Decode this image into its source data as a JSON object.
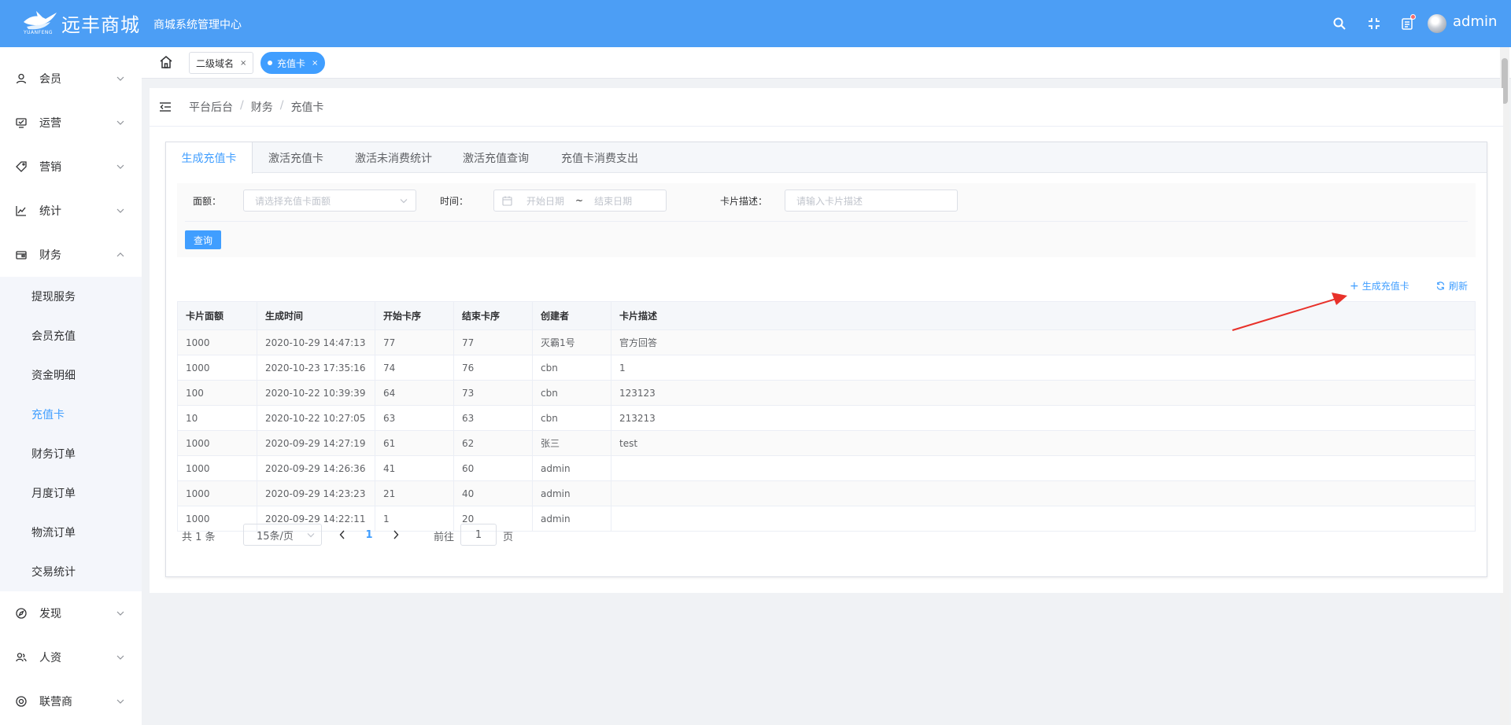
{
  "header": {
    "logo_text": "远丰商城",
    "logo_sub": "YUANFENG",
    "title": "商城系统管理中心",
    "username": "admin",
    "icons": [
      "search-icon",
      "fullscreen-icon",
      "notification-icon"
    ]
  },
  "sidebar": {
    "items": [
      {
        "label": "会员",
        "icon": "user-icon"
      },
      {
        "label": "运营",
        "icon": "monitor-icon"
      },
      {
        "label": "营销",
        "icon": "tag-icon"
      },
      {
        "label": "统计",
        "icon": "chart-line-icon"
      },
      {
        "label": "财务",
        "icon": "wallet-icon"
      },
      {
        "label": "发现",
        "icon": "compass-icon"
      },
      {
        "label": "人资",
        "icon": "people-icon"
      },
      {
        "label": "联营商",
        "icon": "partner-icon"
      }
    ],
    "finance_sub": [
      "提现服务",
      "会员充值",
      "资金明细",
      "充值卡",
      "财务订单",
      "月度订单",
      "物流订单",
      "交易统计"
    ],
    "active_sub": "充值卡"
  },
  "tags": {
    "items": [
      {
        "label": "二级域名"
      },
      {
        "label": "充值卡"
      }
    ],
    "close_glyph": "×"
  },
  "breadcrumb": [
    "平台后台",
    "财务",
    "充值卡"
  ],
  "breadcrumb_sep": "/",
  "tabs": [
    "生成充值卡",
    "激活充值卡",
    "激活未消费统计",
    "激活充值查询",
    "充值卡消费支出"
  ],
  "filters": {
    "amount_label": "面额：",
    "amount_placeholder": "请选择充值卡面额",
    "time_label": "时间：",
    "start_placeholder": "开始日期",
    "range_sep": "~",
    "end_placeholder": "结束日期",
    "desc_label": "卡片描述：",
    "desc_placeholder": "请输入卡片描述",
    "query_button": "查询"
  },
  "actions": {
    "generate": "生成充值卡",
    "refresh": "刷新"
  },
  "table": {
    "columns": [
      "卡片面额",
      "生成时间",
      "开始卡序",
      "结束卡序",
      "创建者",
      "卡片描述"
    ],
    "rows": [
      [
        "1000",
        "2020-10-29 14:47:13",
        "77",
        "77",
        "灭霸1号",
        "官方回答"
      ],
      [
        "1000",
        "2020-10-23 17:35:16",
        "74",
        "76",
        "cbn",
        "1"
      ],
      [
        "100",
        "2020-10-22 10:39:39",
        "64",
        "73",
        "cbn",
        "123123"
      ],
      [
        "10",
        "2020-10-22 10:27:05",
        "63",
        "63",
        "cbn",
        "213213"
      ],
      [
        "1000",
        "2020-09-29 14:27:19",
        "61",
        "62",
        "张三",
        "test"
      ],
      [
        "1000",
        "2020-09-29 14:26:36",
        "41",
        "60",
        "admin",
        ""
      ],
      [
        "1000",
        "2020-09-29 14:23:23",
        "21",
        "40",
        "admin",
        ""
      ],
      [
        "1000",
        "2020-09-29 14:22:11",
        "1",
        "20",
        "admin",
        ""
      ]
    ]
  },
  "pagination": {
    "total": "共 1 条",
    "page_size": "15条/页",
    "current_page": "1",
    "goto_prefix": "前往",
    "goto_value": "1",
    "goto_suffix": "页"
  },
  "colors": {
    "primary": "#409eff",
    "header_bg": "#4c9ef5",
    "annotation_arrow": "#e8312a"
  }
}
